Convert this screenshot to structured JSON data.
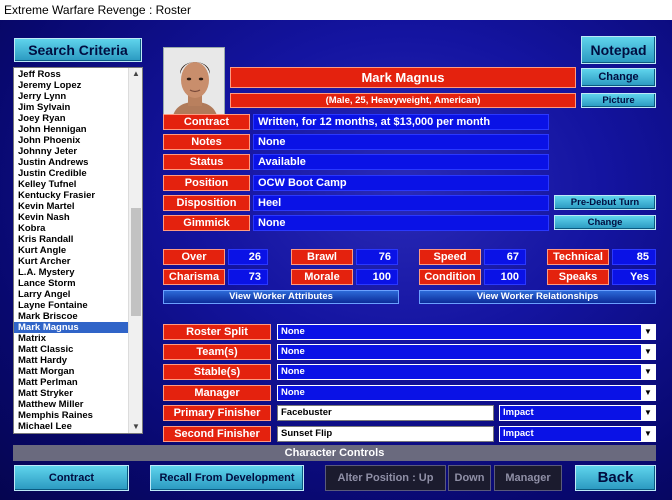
{
  "window": {
    "title": "Extreme Warfare Revenge : Roster"
  },
  "buttons": {
    "search_criteria": "Search Criteria",
    "notepad": "Notepad",
    "change_name": "Change",
    "picture": "Picture",
    "pre_debut_turn": "Pre-Debut Turn",
    "change_gimmick": "Change",
    "view_attributes": "View Worker Attributes",
    "view_relationships": "View Worker Relationships",
    "contract": "Contract",
    "recall_from_development": "Recall From Development",
    "alter_position_up": "Alter Position : Up",
    "down": "Down",
    "manager": "Manager",
    "back": "Back"
  },
  "roster": {
    "items": [
      "Jeff Ross",
      "Jeremy Lopez",
      "Jerry Lynn",
      "Jim Sylvain",
      "Joey Ryan",
      "John Hennigan",
      "John Phoenix",
      "Johnny Jeter",
      "Justin Andrews",
      "Justin Credible",
      "Kelley Tufnel",
      "Kentucky Frasier",
      "Kevin Martel",
      "Kevin Nash",
      "Kobra",
      "Kris Randall",
      "Kurt Angle",
      "Kurt Archer",
      "L.A. Mystery",
      "Lance Storm",
      "Larry Angel",
      "Layne Fontaine",
      "Mark Briscoe",
      "Mark Magnus",
      "Matrix",
      "Matt Classic",
      "Matt Hardy",
      "Matt Morgan",
      "Matt Perlman",
      "Matt Stryker",
      "Matthew Miller",
      "Memphis Raines",
      "Michael Lee"
    ],
    "selected": "Mark Magnus"
  },
  "worker": {
    "name": "Mark Magnus",
    "summary": "(Male, 25, Heavyweight, American)"
  },
  "details": {
    "contract_label": "Contract",
    "contract_value": "Written, for 12 months, at $13,000 per month",
    "notes_label": "Notes",
    "notes_value": "None",
    "status_label": "Status",
    "status_value": "Available",
    "position_label": "Position",
    "position_value": "OCW Boot Camp",
    "disposition_label": "Disposition",
    "disposition_value": "Heel",
    "gimmick_label": "Gimmick",
    "gimmick_value": "None"
  },
  "stats": {
    "over_label": "Over",
    "over": "26",
    "brawl_label": "Brawl",
    "brawl": "76",
    "speed_label": "Speed",
    "speed": "67",
    "technical_label": "Technical",
    "technical": "85",
    "charisma_label": "Charisma",
    "charisma": "73",
    "morale_label": "Morale",
    "morale": "100",
    "condition_label": "Condition",
    "condition": "100",
    "speaks_label": "Speaks",
    "speaks": "Yes"
  },
  "settings": {
    "roster_split_label": "Roster Split",
    "roster_split": "None",
    "teams_label": "Team(s)",
    "teams": "None",
    "stables_label": "Stable(s)",
    "stables": "None",
    "manager_label": "Manager",
    "manager": "None",
    "primary_finisher_label": "Primary Finisher",
    "primary_finisher": "Facebuster",
    "primary_finisher_type": "Impact",
    "second_finisher_label": "Second Finisher",
    "second_finisher": "Sunset Flip",
    "second_finisher_type": "Impact"
  },
  "section": {
    "character_controls": "Character Controls"
  },
  "colors": {
    "red": "#e4220e",
    "blue": "#0a12e6",
    "cyan": "#4ec4e4",
    "background": "#1414a0"
  }
}
